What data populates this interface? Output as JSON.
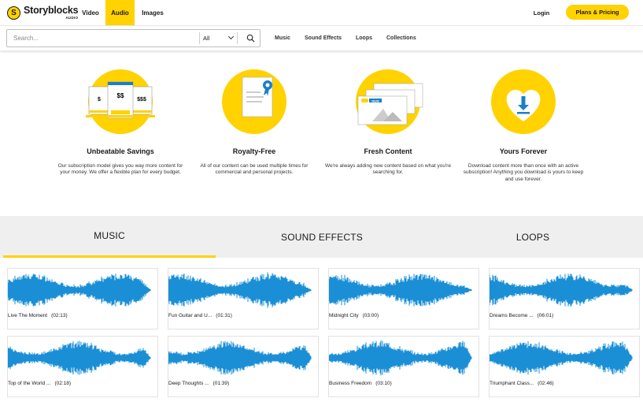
{
  "nav": {
    "logo_name": "Storyblocks",
    "logo_sub": "AUDIO",
    "logo_mark": "S",
    "tabs": [
      "Video",
      "Audio",
      "Images"
    ],
    "active_tab": "Audio",
    "login": "Login",
    "plans": "Plans & Pricing"
  },
  "search": {
    "placeholder": "Search...",
    "scope": "All",
    "categories": [
      "Music",
      "Sound Effects",
      "Loops",
      "Collections"
    ]
  },
  "features": [
    {
      "title": "Unbeatable Savings",
      "desc": "Our subscription model gives you way more content for your money. We offer a flexible plan for every budget.",
      "icon": "price-tags-icon"
    },
    {
      "title": "Royalty-Free",
      "desc": "All of our content can be used multiple times for commercial and personal projects.",
      "icon": "certificate-icon"
    },
    {
      "title": "Fresh Content",
      "desc": "We're always adding new content based on what you're searching for.",
      "icon": "new-content-icon"
    },
    {
      "title": "Yours Forever",
      "desc": "Download content more than once with an active subscription! Anything you download is yours to keep and use forever.",
      "icon": "heart-download-icon"
    }
  ],
  "feature_icon_text": {
    "price1": "$",
    "price2": "$$",
    "price3": "$$$",
    "new": "NEW"
  },
  "content_tabs": [
    "MUSIC",
    "SOUND EFFECTS",
    "LOOPS"
  ],
  "active_content_tab": "MUSIC",
  "tracks": [
    {
      "title": "Live The Moment",
      "duration": "(02:13)"
    },
    {
      "title": "Fun Guitar and U...",
      "duration": "(01:31)"
    },
    {
      "title": "Midnight City",
      "duration": "(03:00)"
    },
    {
      "title": "Dreams Become ...",
      "duration": "(06:01)"
    },
    {
      "title": "Top of the World ...",
      "duration": "(02:18)"
    },
    {
      "title": "Deep Thoughts ...",
      "duration": "(01:39)"
    },
    {
      "title": "Business Freedom",
      "duration": "(03:10)"
    },
    {
      "title": "Triumphant Class...",
      "duration": "(02:46)"
    }
  ],
  "colors": {
    "accent": "#ffd200",
    "waveform": "#1b8fd6",
    "text": "#1a1a1a"
  }
}
